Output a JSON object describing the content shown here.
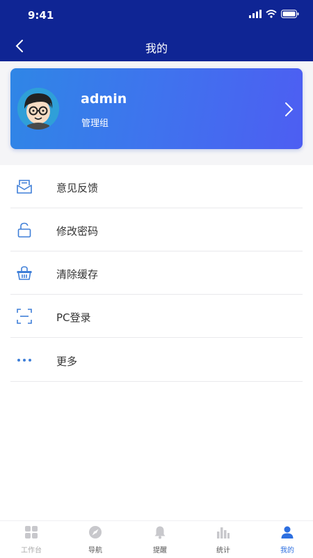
{
  "status_bar": {
    "time": "9:41"
  },
  "nav": {
    "title": "我的"
  },
  "profile": {
    "username": "admin",
    "group": "管理组"
  },
  "menu": {
    "items": [
      {
        "label": "意见反馈",
        "icon": "feedback-mail-icon"
      },
      {
        "label": "修改密码",
        "icon": "lock-icon"
      },
      {
        "label": "清除缓存",
        "icon": "basket-icon"
      },
      {
        "label": "PC登录",
        "icon": "scan-icon"
      },
      {
        "label": "更多",
        "icon": "more-dots-icon"
      }
    ]
  },
  "tabbar": {
    "tabs": [
      {
        "label": "工作台",
        "icon": "grid-icon"
      },
      {
        "label": "导航",
        "icon": "compass-icon"
      },
      {
        "label": "提醒",
        "icon": "bell-icon"
      },
      {
        "label": "统计",
        "icon": "bar-chart-icon"
      },
      {
        "label": "我的",
        "icon": "user-icon",
        "active": true
      }
    ]
  },
  "colors": {
    "header": "#0f2594",
    "accent": "#2d6fe0",
    "icon": "#3f7fd8"
  }
}
